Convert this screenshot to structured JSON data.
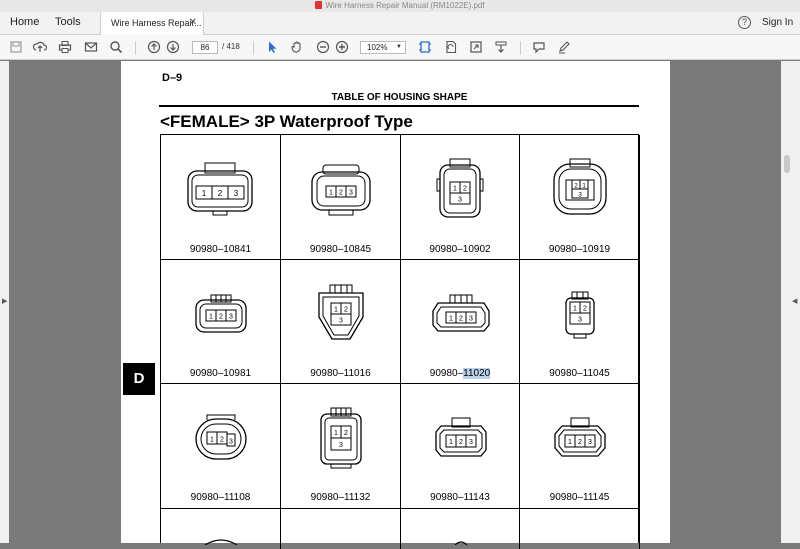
{
  "window": {
    "title": "Wire Harness Repair Manual (RM1022E).pdf"
  },
  "tabs": {
    "home": "Home",
    "tools": "Tools",
    "document": "Wire Harness Repair..."
  },
  "header": {
    "help": "?",
    "signin": "Sign In"
  },
  "toolbar": {
    "page_current": "86",
    "page_total": "/ 418",
    "zoom": "102%"
  },
  "document": {
    "page_label": "D–9",
    "table_title": "TABLE OF HOUSING SHAPE",
    "section_heading": "<FEMALE> 3P Waterproof Type",
    "side_tab": "D",
    "row1": [
      "90980–10841",
      "90980–10845",
      "90980–10902",
      "90980–10919"
    ],
    "row2": [
      "90980–10981",
      "90980–11016",
      "90980–",
      "90980–11045"
    ],
    "row2_highlight": "11020",
    "row3": [
      "90980–11108",
      "90980–11132",
      "90980–11143",
      "90980–11145"
    ],
    "pins": [
      "1",
      "2",
      "3"
    ]
  },
  "colors": {
    "highlight": "#b8d0ea",
    "pdf_red": "#dd3333",
    "accent_blue": "#2b6fd6"
  }
}
